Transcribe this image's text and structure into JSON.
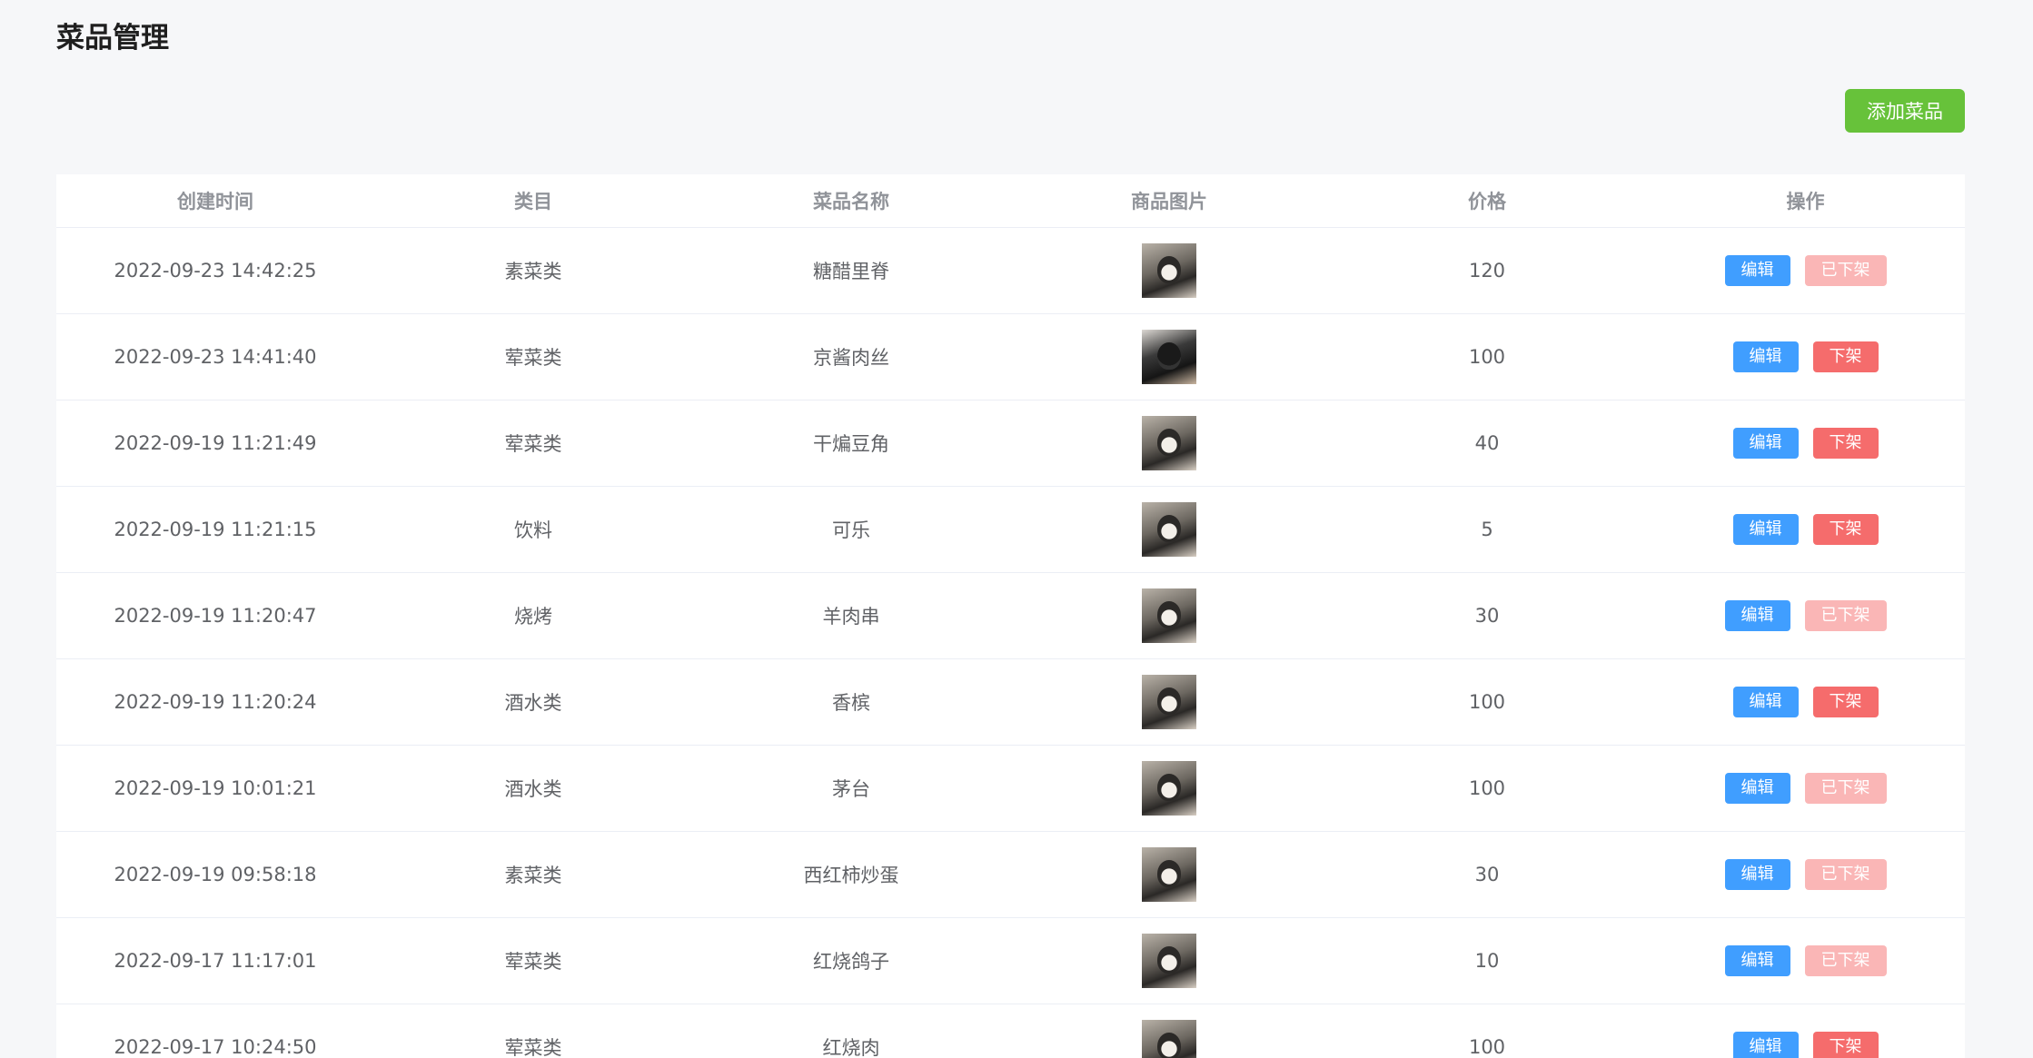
{
  "page_title": "菜品管理",
  "add_button_label": "添加菜品",
  "colors": {
    "accent_green": "#67c23a",
    "edit_blue": "#409eff",
    "danger_red": "#f56c6c",
    "danger_red_disabled": "#fab6b6"
  },
  "table": {
    "columns": [
      "创建时间",
      "类目",
      "菜品名称",
      "商品图片",
      "价格",
      "操作"
    ],
    "edit_label": "编辑",
    "rows": [
      {
        "created": "2022-09-23 14:42:25",
        "category": "素菜类",
        "name": "糖醋里脊",
        "image_icon": "husky-photo",
        "price": "120",
        "status_label": "已下架",
        "status_disabled": true
      },
      {
        "created": "2022-09-23 14:41:40",
        "category": "荤菜类",
        "name": "京酱肉丝",
        "image_icon": "black-dog-photo",
        "price": "100",
        "status_label": "下架",
        "status_disabled": false
      },
      {
        "created": "2022-09-19 11:21:49",
        "category": "荤菜类",
        "name": "干煸豆角",
        "image_icon": "husky-photo",
        "price": "40",
        "status_label": "下架",
        "status_disabled": false
      },
      {
        "created": "2022-09-19 11:21:15",
        "category": "饮料",
        "name": "可乐",
        "image_icon": "husky-photo",
        "price": "5",
        "status_label": "下架",
        "status_disabled": false
      },
      {
        "created": "2022-09-19 11:20:47",
        "category": "烧烤",
        "name": "羊肉串",
        "image_icon": "husky-photo",
        "price": "30",
        "status_label": "已下架",
        "status_disabled": true
      },
      {
        "created": "2022-09-19 11:20:24",
        "category": "酒水类",
        "name": "香槟",
        "image_icon": "husky-photo",
        "price": "100",
        "status_label": "下架",
        "status_disabled": false
      },
      {
        "created": "2022-09-19 10:01:21",
        "category": "酒水类",
        "name": "茅台",
        "image_icon": "husky-photo",
        "price": "100",
        "status_label": "已下架",
        "status_disabled": true
      },
      {
        "created": "2022-09-19 09:58:18",
        "category": "素菜类",
        "name": "西红柿炒蛋",
        "image_icon": "husky-photo",
        "price": "30",
        "status_label": "已下架",
        "status_disabled": true
      },
      {
        "created": "2022-09-17 11:17:01",
        "category": "荤菜类",
        "name": "红烧鸽子",
        "image_icon": "husky-photo",
        "price": "10",
        "status_label": "已下架",
        "status_disabled": true
      },
      {
        "created": "2022-09-17 10:24:50",
        "category": "荤菜类",
        "name": "红烧肉",
        "image_icon": "husky-photo",
        "price": "100",
        "status_label": "下架",
        "status_disabled": false
      }
    ]
  }
}
